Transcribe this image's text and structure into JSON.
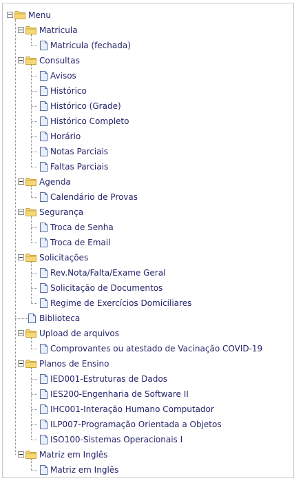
{
  "menu": {
    "root_label": "Menu",
    "items": [
      {
        "label": "Matricula",
        "type": "folder",
        "children": [
          {
            "label": "Matricula (fechada)"
          }
        ]
      },
      {
        "label": "Consultas",
        "type": "folder",
        "children": [
          {
            "label": "Avisos"
          },
          {
            "label": "Histórico"
          },
          {
            "label": "Histórico (Grade)"
          },
          {
            "label": "Histórico Completo"
          },
          {
            "label": "Horário"
          },
          {
            "label": "Notas Parciais"
          },
          {
            "label": "Faltas Parciais"
          }
        ]
      },
      {
        "label": "Agenda",
        "type": "folder",
        "children": [
          {
            "label": "Calendário de Provas"
          }
        ]
      },
      {
        "label": "Segurança",
        "type": "folder",
        "children": [
          {
            "label": "Troca de Senha"
          },
          {
            "label": "Troca de Email"
          }
        ]
      },
      {
        "label": "Solicitações",
        "type": "folder",
        "children": [
          {
            "label": "Rev.Nota/Falta/Exame Geral"
          },
          {
            "label": "Solicitação de Documentos"
          },
          {
            "label": "Regime de Exercícios Domiciliares"
          }
        ]
      },
      {
        "label": "Biblioteca",
        "type": "page"
      },
      {
        "label": "Upload de arquivos",
        "type": "folder",
        "children": [
          {
            "label": "Comprovantes ou atestado de Vacinação COVID-19"
          }
        ]
      },
      {
        "label": "Planos de Ensino",
        "type": "folder",
        "children": [
          {
            "label": "IED001-Estruturas de Dados"
          },
          {
            "label": "IES200-Engenharia de Software II"
          },
          {
            "label": "IHC001-Interação Humano Computador"
          },
          {
            "label": "ILP007-Programação Orientada a Objetos"
          },
          {
            "label": "ISO100-Sistemas Operacionais I"
          }
        ]
      },
      {
        "label": "Matriz em Inglês",
        "type": "folder",
        "children": [
          {
            "label": "Matriz em Inglês"
          }
        ]
      }
    ]
  },
  "colors": {
    "text": "#24246b",
    "folder": "#f5d774",
    "folder_border": "#c9a43a",
    "page_border": "#5a6f9e",
    "page_fill": "#eaf0fb"
  }
}
